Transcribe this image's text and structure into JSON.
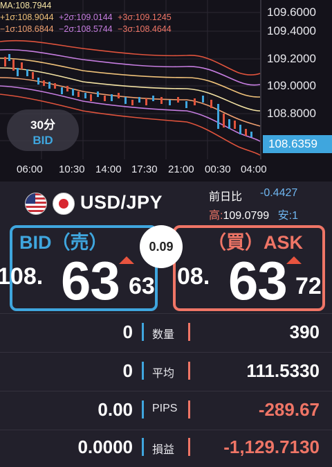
{
  "legend": {
    "ma": "MA:108.7944",
    "p1": "+1σ:108.9044",
    "p2": "+2σ:109.0144",
    "p3": "+3σ:109.1245",
    "m1": "−1σ:108.6844",
    "m2": "−2σ:108.5744",
    "m3": "−3σ:108.4644"
  },
  "y_axis": [
    "109.6000",
    "109.4000",
    "109.2000",
    "109.0000",
    "108.8000"
  ],
  "current_price_tag": "108.6359",
  "x_axis": [
    "06:00",
    "10:30",
    "14:00",
    "17:30",
    "21:00",
    "00:30",
    "04:00"
  ],
  "period": {
    "interval": "30分",
    "side": "BID"
  },
  "pair": {
    "name": "USD/JPY",
    "prev_label": "前日比",
    "prev_value": "-0.4427",
    "high_label": "高:",
    "high_value": "109.0799",
    "low_label": "安:1"
  },
  "bid": {
    "title": "BID（売）",
    "prefix": "108.",
    "big": "63",
    "tail": "63"
  },
  "ask": {
    "title": "（買）ASK",
    "prefix": "08.",
    "big": "63",
    "tail": "72"
  },
  "spread": "0.09",
  "stats": [
    {
      "left": "0",
      "label": "数量",
      "right": "390",
      "right_color": "#ffffff"
    },
    {
      "left": "0",
      "label": "平均",
      "right": "111.5330",
      "right_color": "#ffffff"
    },
    {
      "left": "0.00",
      "label": "PIPS",
      "right": "-289.67",
      "right_color": "#ef7566"
    },
    {
      "left": "0.0000",
      "label": "損益",
      "right": "-1,129.7130",
      "right_color": "#ef7566"
    }
  ],
  "colors": {
    "bid": "#3fa6de",
    "ask": "#ef7566",
    "background": "#22202b"
  }
}
